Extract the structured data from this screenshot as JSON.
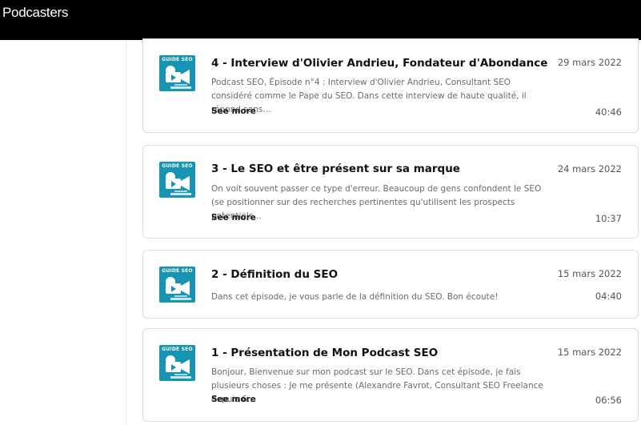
{
  "header": {
    "title": "Podcasters"
  },
  "episodes": [
    {
      "title": "4 - Interview d'Olivier Andrieu, Fondateur d'Abondance",
      "date": "29 mars 2022",
      "description": "Podcast SEO, Épisode n°4 : Interview d'Olivier Andrieu, Consultant SEO considéré comme le Pape du SEO. Dans cette interview de haute qualité, il répond sans…",
      "more_label": "See more",
      "duration": "40:46",
      "thumbnail_label": "GUIDE SEO"
    },
    {
      "title": "3 - Le SEO et être présent sur sa marque",
      "date": "24 mars 2022",
      "description": "On voit souvent passer ce type d'erreur. Beaucoup de gens confondent le SEO (se positionner sur des recherches pertinentes qu'utilisent les prospects potentiels…",
      "more_label": "See more",
      "duration": "10:37",
      "thumbnail_label": "GUIDE SEO"
    },
    {
      "title": "2 - Définition du SEO",
      "date": "15 mars 2022",
      "description": "Dans cet épisode, je vous parle de la définition du SEO. Bon écoute!",
      "duration": "04:40",
      "thumbnail_label": "GUIDE SEO"
    },
    {
      "title": "1 - Présentation de Mon Podcast SEO",
      "date": "15 mars 2022",
      "description": "Bonjour, Bienvenue sur mon podcast sur le SEO.  Dans cet épisode, je fais plusieurs choses :  Je me présente (Alexandre Favrot, Consultant SEO Freelance depuis 6…",
      "more_label": "See more",
      "duration": "06:56",
      "thumbnail_label": "GUIDE SEO"
    }
  ]
}
